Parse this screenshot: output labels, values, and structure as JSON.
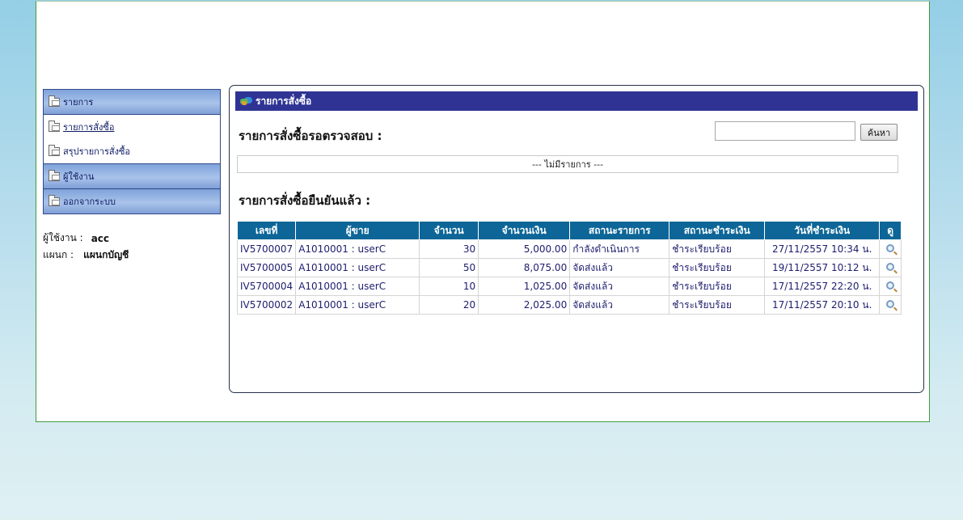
{
  "sidebar": {
    "menu_header": "รายการ",
    "items": [
      {
        "label": "รายการสั่งซื้อ"
      },
      {
        "label": "สรุปรายการสั่งซื้อ"
      }
    ],
    "users_header": "ผู้ใช้งาน",
    "logout_header": "ออกจากระบบ"
  },
  "user_info": {
    "user_label": "ผู้ใช้งาน :",
    "user_value": "acc",
    "dept_label": "แผนก :",
    "dept_value": "แผนกบัญชี"
  },
  "panel": {
    "title": "รายการสั่งซื้อ",
    "pending_title": "รายการสั่งซื้อรอตรวจสอบ :",
    "search_placeholder": "",
    "search_button": "ค้นหา",
    "empty_message": "--- ไม่มีรายการ ---",
    "confirmed_title": "รายการสั่งซื้อยืนยันแล้ว :"
  },
  "table": {
    "columns": [
      "เลขที่",
      "ผู้ขาย",
      "จำนวน",
      "จำนวนเงิน",
      "สถานะรายการ",
      "สถานะชำระเงิน",
      "วันที่ชำระเงิน",
      "ดู"
    ],
    "rows": [
      {
        "no": "IV5700007",
        "seller": "A1010001 : userC",
        "qty": "30",
        "amount": "5,000.00",
        "status": "กำลังดำเนินการ",
        "payment": "ชำระเรียบร้อย",
        "date": "27/11/2557 10:34 น."
      },
      {
        "no": "IV5700005",
        "seller": "A1010001 : userC",
        "qty": "50",
        "amount": "8,075.00",
        "status": "จัดส่งแล้ว",
        "payment": "ชำระเรียบร้อย",
        "date": "19/11/2557 10:12 น."
      },
      {
        "no": "IV5700004",
        "seller": "A1010001 : userC",
        "qty": "10",
        "amount": "1,025.00",
        "status": "จัดส่งแล้ว",
        "payment": "ชำระเรียบร้อย",
        "date": "17/11/2557 22:20 น."
      },
      {
        "no": "IV5700002",
        "seller": "A1010001 : userC",
        "qty": "20",
        "amount": "2,025.00",
        "status": "จัดส่งแล้ว",
        "payment": "ชำระเรียบร้อย",
        "date": "17/11/2557 20:10 น."
      }
    ]
  },
  "icons": {
    "folder": "folder-icon",
    "cart": "cart-icon",
    "view": "magnifier-icon"
  },
  "colors": {
    "panel_header": "#2f3494",
    "table_header": "#0d6697",
    "sidebar_header": "#a9c3ea",
    "text": "#1d1d6e"
  }
}
